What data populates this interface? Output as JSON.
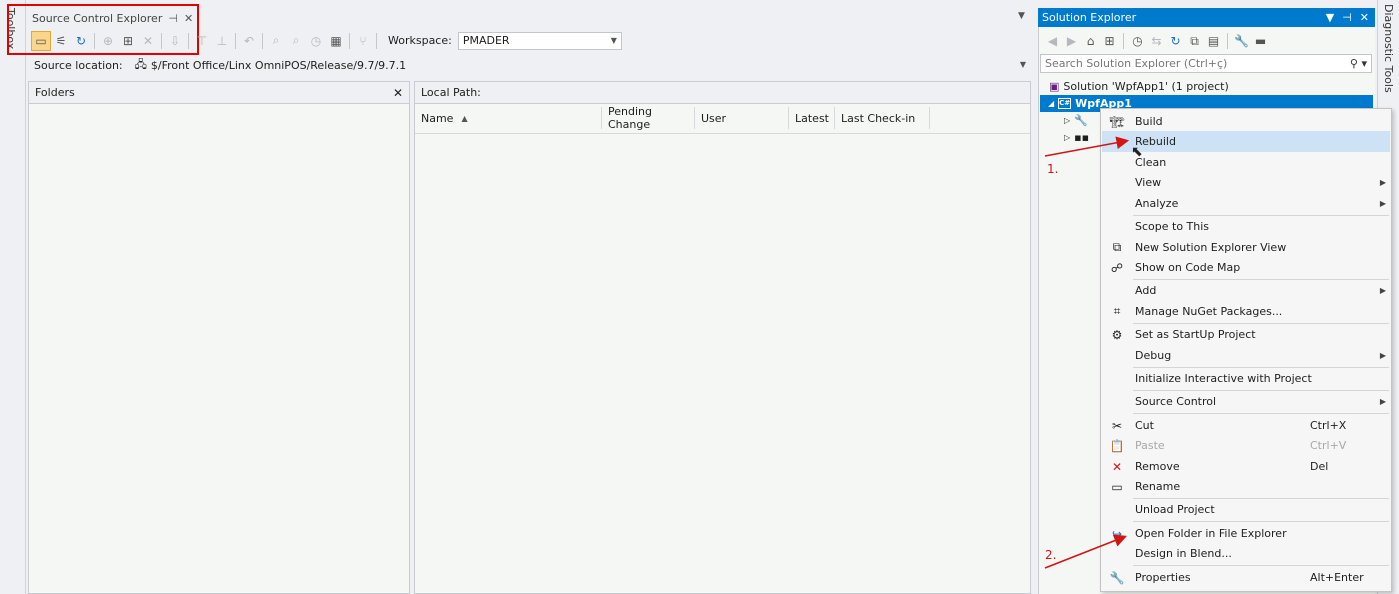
{
  "left_strip": {
    "label": "Toolbox"
  },
  "right_strip": {
    "label": "Diagnostic Tools"
  },
  "sce": {
    "tab_title": "Source Control Explorer",
    "tab_pin": "⊣",
    "tab_close": "✕",
    "workspace_label": "Workspace:",
    "workspace_value": "PMADER",
    "source_location_label": "Source location:",
    "source_location_path": "$/Front Office/Linx OmniPOS/Release/9.7/9.7.1",
    "folders_title": "Folders",
    "folders_close": "✕",
    "local_path_label": "Local Path:",
    "columns": [
      "Name",
      "Pending Change",
      "User",
      "Latest",
      "Last Check-in"
    ]
  },
  "solution_explorer": {
    "title": "Solution Explorer",
    "pin": "⊣",
    "close": "✕",
    "search_placeholder": "Search Solution Explorer (Ctrl+ç)",
    "solution_label": "Solution 'WpfApp1' (1 project)",
    "project_label": "WpfApp1",
    "project_icon": "C#"
  },
  "context_menu": {
    "items": [
      {
        "label": "Build",
        "icon": "build-icon"
      },
      {
        "label": "Rebuild",
        "highlighted": true
      },
      {
        "label": "Clean"
      },
      {
        "label": "View",
        "submenu": true
      },
      {
        "label": "Analyze",
        "submenu": true
      },
      {
        "label": "Scope to This"
      },
      {
        "label": "New Solution Explorer View",
        "icon": "new-view-icon"
      },
      {
        "label": "Show on Code Map",
        "icon": "code-map-icon"
      },
      {
        "label": "Add",
        "submenu": true
      },
      {
        "label": "Manage NuGet Packages...",
        "icon": "nuget-icon"
      },
      {
        "label": "Set as StartUp Project",
        "icon": "gear-icon"
      },
      {
        "label": "Debug",
        "submenu": true
      },
      {
        "label": "Initialize Interactive with Project"
      },
      {
        "label": "Source Control",
        "submenu": true
      },
      {
        "label": "Cut",
        "shortcut": "Ctrl+X",
        "icon": "scissors-icon"
      },
      {
        "label": "Paste",
        "shortcut": "Ctrl+V",
        "disabled": true,
        "icon": "paste-icon"
      },
      {
        "label": "Remove",
        "shortcut": "Del",
        "icon": "remove-icon"
      },
      {
        "label": "Rename",
        "icon": "rename-icon"
      },
      {
        "label": "Unload Project"
      },
      {
        "label": "Open Folder in File Explorer",
        "icon": "refresh-arrow-icon"
      },
      {
        "label": "Design in Blend..."
      },
      {
        "label": "Properties",
        "shortcut": "Alt+Enter",
        "icon": "wrench-icon"
      }
    ]
  },
  "annotations": {
    "step1": "1.",
    "step2": "2."
  },
  "colors": {
    "accent": "#007acc",
    "annotation": "#d21414",
    "menu_highlight": "#cde2f5"
  }
}
